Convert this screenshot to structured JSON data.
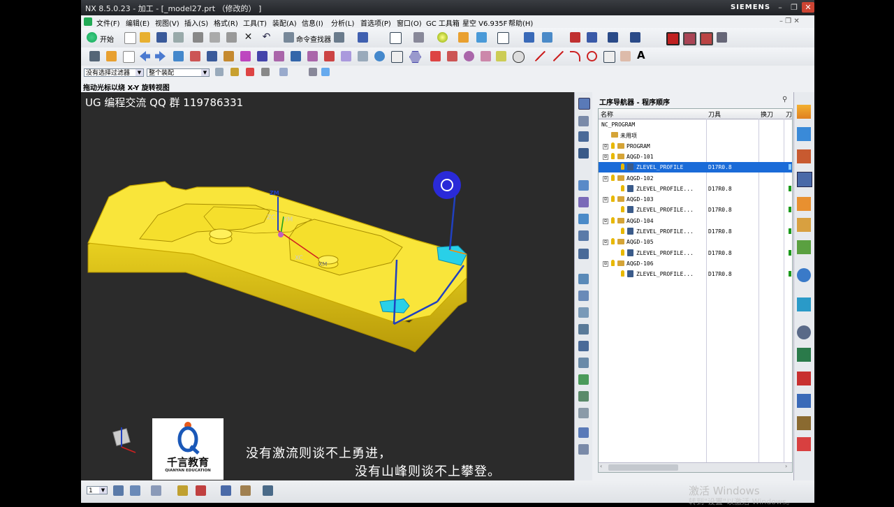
{
  "window": {
    "title": "NX 8.5.0.23 - 加工 - [_model27.prt （修改的） ]",
    "brand": "SIEMENS",
    "min": "–",
    "max": "❐",
    "close": "✕"
  },
  "menu": [
    "文件(F)",
    "编辑(E)",
    "视图(V)",
    "插入(S)",
    "格式(R)",
    "工具(T)",
    "装配(A)",
    "信息(I)",
    "分析(L)",
    "首选项(P)",
    "窗口(O)",
    "GC 工具箱",
    "星空 V6.935F",
    "帮助(H)"
  ],
  "toolbar": {
    "start_label": "开始",
    "find_command_label": "命令查找器"
  },
  "filter": {
    "selection_filter": "没有选择过滤器",
    "assembly_scope": "整个装配"
  },
  "status_hint": "拖动光标以绕 X-Y 旋转视图",
  "viewport": {
    "title": "UG 编程交流 QQ 群 119786331",
    "axis_labels": {
      "zm": "ZM",
      "zc": "ZC",
      "ym": "YM",
      "xc": "XC",
      "xm": "XM"
    },
    "logo": {
      "chinese": "千言教育",
      "english": "QIANYAN EDUCATION"
    },
    "subtitle_line1": "没有激流则谈不上勇进，",
    "subtitle_line2": "没有山峰则谈不上攀登。",
    "part_color": "#f9e53a"
  },
  "navigator": {
    "title": "工序导航器 - 程序顺序",
    "columns": {
      "name": "名称",
      "tool": "刀具",
      "toolchange": "换刀",
      "extra": "刀"
    },
    "rows": [
      {
        "name": "NC_PROGRAM",
        "tool": "",
        "level": 0,
        "kind": "root"
      },
      {
        "name": "未用项",
        "tool": "",
        "level": 1,
        "kind": "folder"
      },
      {
        "name": "PROGRAM",
        "tool": "",
        "level": 1,
        "kind": "program",
        "expander": "⊟"
      },
      {
        "name": "AQGD-101",
        "tool": "",
        "level": 2,
        "kind": "program",
        "expander": "⊟"
      },
      {
        "name": "ZLEVEL_PROFILE",
        "tool": "D17R0.8",
        "level": 3,
        "kind": "op",
        "selected": true
      },
      {
        "name": "AQGD-102",
        "tool": "",
        "level": 2,
        "kind": "program",
        "expander": "⊟"
      },
      {
        "name": "ZLEVEL_PROFILE...",
        "tool": "D17R0.8",
        "level": 3,
        "kind": "op"
      },
      {
        "name": "AQGD-103",
        "tool": "",
        "level": 2,
        "kind": "program",
        "expander": "⊟"
      },
      {
        "name": "ZLEVEL_PROFILE...",
        "tool": "D17R0.8",
        "level": 3,
        "kind": "op"
      },
      {
        "name": "AQGD-104",
        "tool": "",
        "level": 2,
        "kind": "program",
        "expander": "⊟"
      },
      {
        "name": "ZLEVEL_PROFILE...",
        "tool": "D17R0.8",
        "level": 3,
        "kind": "op"
      },
      {
        "name": "AQGD-105",
        "tool": "",
        "level": 2,
        "kind": "program",
        "expander": "⊟"
      },
      {
        "name": "ZLEVEL_PROFILE...",
        "tool": "D17R0.8",
        "level": 3,
        "kind": "op"
      },
      {
        "name": "AQGD-106",
        "tool": "",
        "level": 2,
        "kind": "program",
        "expander": "⊟"
      },
      {
        "name": "ZLEVEL_PROFILE...",
        "tool": "D17R0.8",
        "level": 3,
        "kind": "op"
      }
    ]
  },
  "statusbar": {
    "layer_value": "1"
  },
  "os_watermark": {
    "line1": "激活 Windows",
    "line2": "转到\"设置\"以激活 Windows。"
  },
  "colors": {
    "selection": "#1a6bd8",
    "check": "#1b9a1b",
    "bulb": "#e8b800",
    "wcs_blue": "#2040c0"
  }
}
